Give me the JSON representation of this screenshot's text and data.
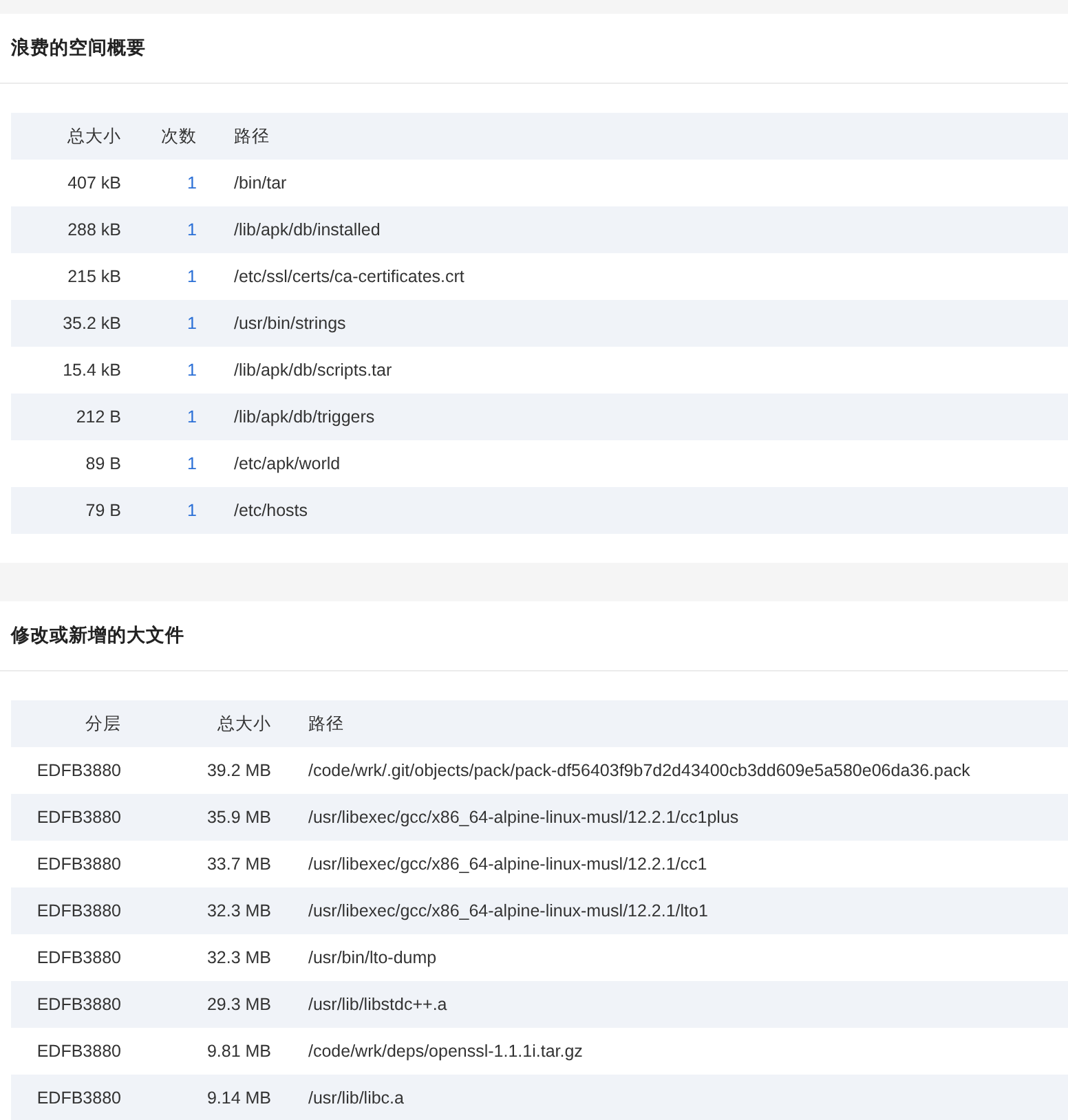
{
  "sections": [
    {
      "title": "浪费的空间概要",
      "columns": [
        "总大小",
        "次数",
        "路径"
      ],
      "rows": [
        [
          "407 kB",
          "1",
          "/bin/tar"
        ],
        [
          "288 kB",
          "1",
          "/lib/apk/db/installed"
        ],
        [
          "215 kB",
          "1",
          "/etc/ssl/certs/ca-certificates.crt"
        ],
        [
          "35.2 kB",
          "1",
          "/usr/bin/strings"
        ],
        [
          "15.4 kB",
          "1",
          "/lib/apk/db/scripts.tar"
        ],
        [
          "212 B",
          "1",
          "/lib/apk/db/triggers"
        ],
        [
          "89 B",
          "1",
          "/etc/apk/world"
        ],
        [
          "79 B",
          "1",
          "/etc/hosts"
        ]
      ]
    },
    {
      "title": "修改或新增的大文件",
      "columns": [
        "分层",
        "总大小",
        "路径"
      ],
      "rows": [
        [
          "EDFB3880",
          "39.2 MB",
          "/code/wrk/.git/objects/pack/pack-df56403f9b7d2d43400cb3dd609e5a580e06da36.pack"
        ],
        [
          "EDFB3880",
          "35.9 MB",
          "/usr/libexec/gcc/x86_64-alpine-linux-musl/12.2.1/cc1plus"
        ],
        [
          "EDFB3880",
          "33.7 MB",
          "/usr/libexec/gcc/x86_64-alpine-linux-musl/12.2.1/cc1"
        ],
        [
          "EDFB3880",
          "32.3 MB",
          "/usr/libexec/gcc/x86_64-alpine-linux-musl/12.2.1/lto1"
        ],
        [
          "EDFB3880",
          "32.3 MB",
          "/usr/bin/lto-dump"
        ],
        [
          "EDFB3880",
          "29.3 MB",
          "/usr/lib/libstdc++.a"
        ],
        [
          "EDFB3880",
          "9.81 MB",
          "/code/wrk/deps/openssl-1.1.1i.tar.gz"
        ],
        [
          "EDFB3880",
          "9.14 MB",
          "/usr/lib/libc.a"
        ]
      ]
    }
  ]
}
